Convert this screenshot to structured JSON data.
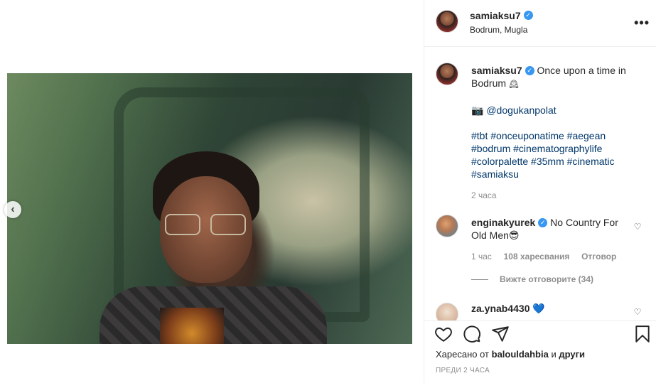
{
  "post": {
    "username": "samiaksu7",
    "location": "Bodrum, Mugla",
    "more_glyph": "•••",
    "caption": {
      "text_before": "Once upon a time in",
      "text_line2": "Bodrum",
      "hat_emoji": "🕰",
      "camera_emoji": "📷",
      "mention": "@dogukanpolat",
      "hashtags_line1": "#tbt #onceuponatime #aegean",
      "hashtags_line2": "#bodrum #cinematographylife",
      "hashtags_line3": "#colorpalette #35mm #cinematic",
      "hashtags_line4": "#samiaksu",
      "time": "2 часа"
    }
  },
  "comments": [
    {
      "username": "enginakyurek",
      "text": "No Country For",
      "text_line2": "Old Men",
      "emoji": "😎",
      "time": "1 час",
      "likes": "108 харесвания",
      "reply": "Отговор",
      "view_replies": "Вижте отговорите (34)"
    },
    {
      "username": "za.ynab4430",
      "emoji": "💙"
    }
  ],
  "footer": {
    "liked_prefix": "Харесано от",
    "liked_user": "balouldahbia",
    "liked_and": "и",
    "liked_others": "други",
    "time_ago": "ПРЕДИ 2 ЧАСА"
  },
  "media": {
    "prev_glyph": "‹"
  },
  "colors": {
    "verified": "#3897f0",
    "hashtag": "#00376b",
    "muted": "#8e8e8e"
  }
}
